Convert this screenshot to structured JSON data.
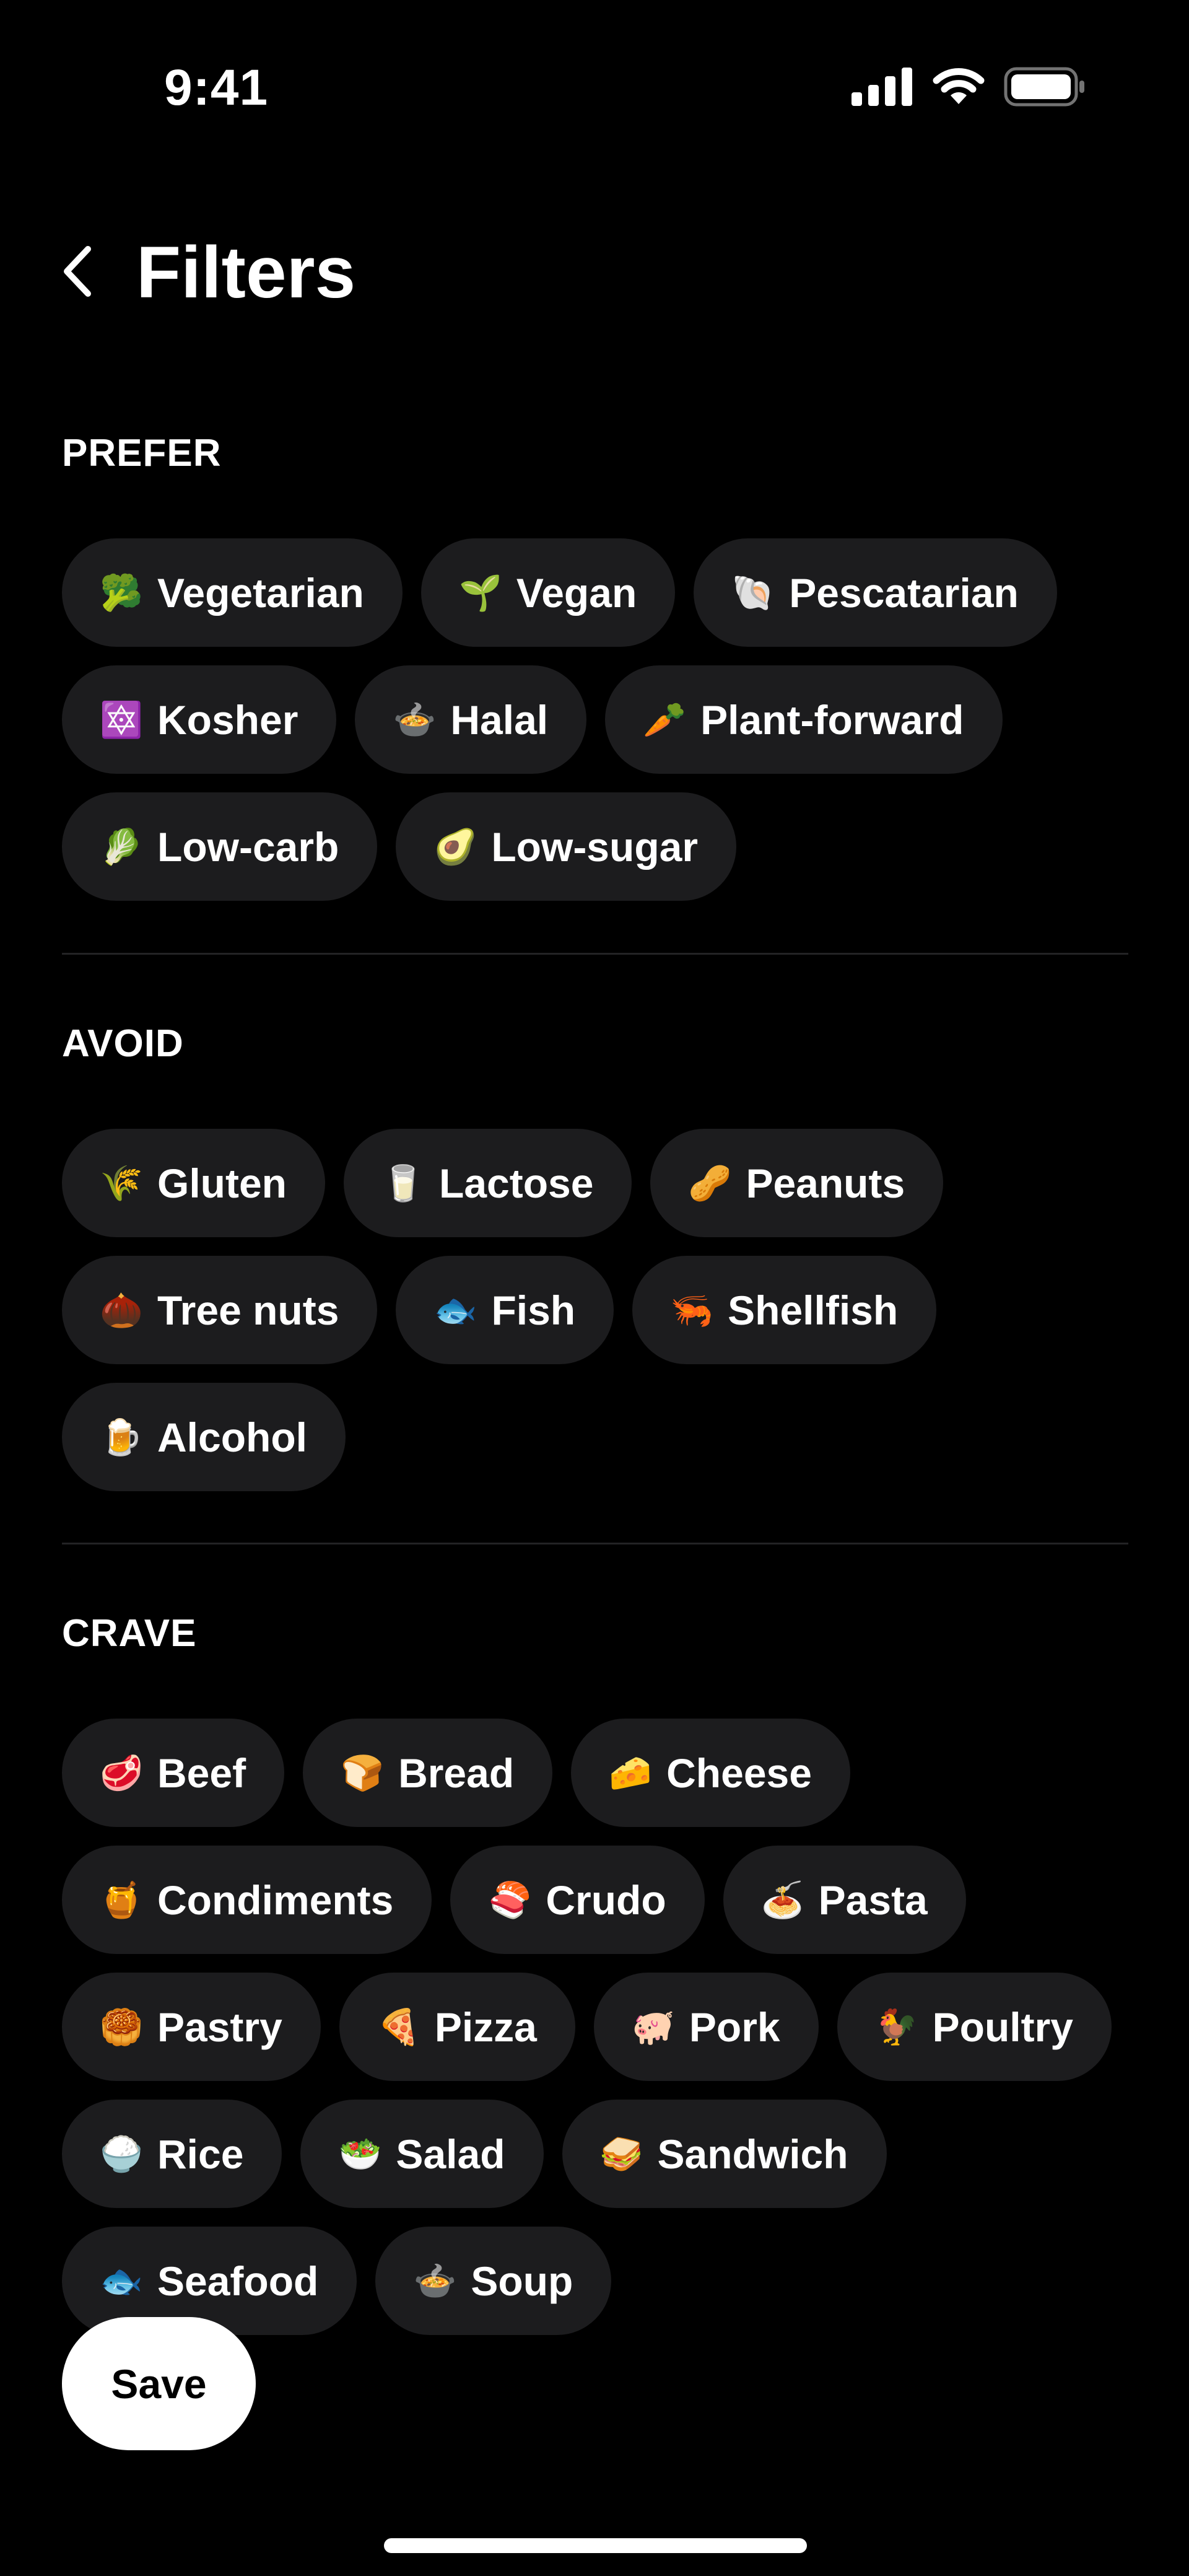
{
  "status_bar": {
    "time": "9:41",
    "icons": [
      "cellular-signal-icon",
      "wifi-icon",
      "battery-icon"
    ]
  },
  "header": {
    "back_icon": "chevron-left-icon",
    "title": "Filters"
  },
  "sections": [
    {
      "title": "PREFER",
      "chips": [
        {
          "emoji": "🥦",
          "label": "Vegetarian"
        },
        {
          "emoji": "🌱",
          "label": "Vegan"
        },
        {
          "emoji": "🐚",
          "label": "Pescatarian"
        },
        {
          "emoji": "🔯",
          "label": "Kosher"
        },
        {
          "emoji": "🍲",
          "label": "Halal"
        },
        {
          "emoji": "🥕",
          "label": "Plant-forward"
        },
        {
          "emoji": "🥬",
          "label": "Low-carb"
        },
        {
          "emoji": "🥑",
          "label": "Low-sugar"
        }
      ]
    },
    {
      "title": "AVOID",
      "chips": [
        {
          "emoji": "🌾",
          "label": "Gluten"
        },
        {
          "emoji": "🥛",
          "label": "Lactose"
        },
        {
          "emoji": "🥜",
          "label": "Peanuts"
        },
        {
          "emoji": "🌰",
          "label": "Tree nuts"
        },
        {
          "emoji": "🐟",
          "label": "Fish"
        },
        {
          "emoji": "🦐",
          "label": "Shellfish"
        },
        {
          "emoji": "🍺",
          "label": "Alcohol"
        }
      ]
    },
    {
      "title": "CRAVE",
      "chips": [
        {
          "emoji": "🥩",
          "label": "Beef"
        },
        {
          "emoji": "🍞",
          "label": "Bread"
        },
        {
          "emoji": "🧀",
          "label": "Cheese"
        },
        {
          "emoji": "🍯",
          "label": "Condiments"
        },
        {
          "emoji": "🍣",
          "label": "Crudo"
        },
        {
          "emoji": "🍝",
          "label": "Pasta"
        },
        {
          "emoji": "🥮",
          "label": "Pastry"
        },
        {
          "emoji": "🍕",
          "label": "Pizza"
        },
        {
          "emoji": "🐖",
          "label": "Pork"
        },
        {
          "emoji": "🐓",
          "label": "Poultry"
        },
        {
          "emoji": "🍚",
          "label": "Rice"
        },
        {
          "emoji": "🥗",
          "label": "Salad"
        },
        {
          "emoji": "🥪",
          "label": "Sandwich"
        },
        {
          "emoji": "🐟",
          "label": "Seafood"
        },
        {
          "emoji": "🍲",
          "label": "Soup"
        }
      ]
    }
  ],
  "save_button": {
    "label": "Save"
  },
  "colors": {
    "background": "#000000",
    "chip_background": "#1c1c1e",
    "divider": "#232325",
    "text": "#ffffff",
    "save_background": "#ffffff",
    "save_text": "#000000"
  }
}
